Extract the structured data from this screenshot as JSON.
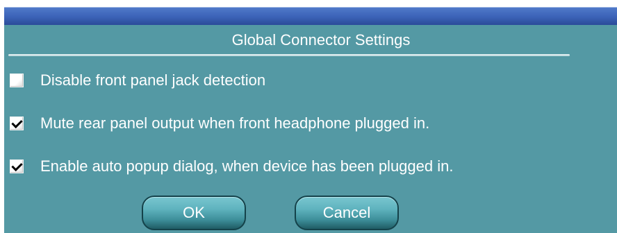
{
  "dialog": {
    "section_title": "Global Connector Settings",
    "options": [
      {
        "label": "Disable front panel jack detection",
        "checked": false
      },
      {
        "label": "Mute rear panel output when front headphone plugged in.",
        "checked": true
      },
      {
        "label": "Enable auto popup dialog, when device has been plugged in.",
        "checked": true
      }
    ],
    "buttons": {
      "ok": "OK",
      "cancel": "Cancel"
    }
  },
  "colors": {
    "dialog_background": "#5499a4",
    "title_bar_blue": "#3c63b8",
    "text": "#ffffff"
  },
  "icons": {
    "checkbox_checked": "checkmark-icon"
  }
}
